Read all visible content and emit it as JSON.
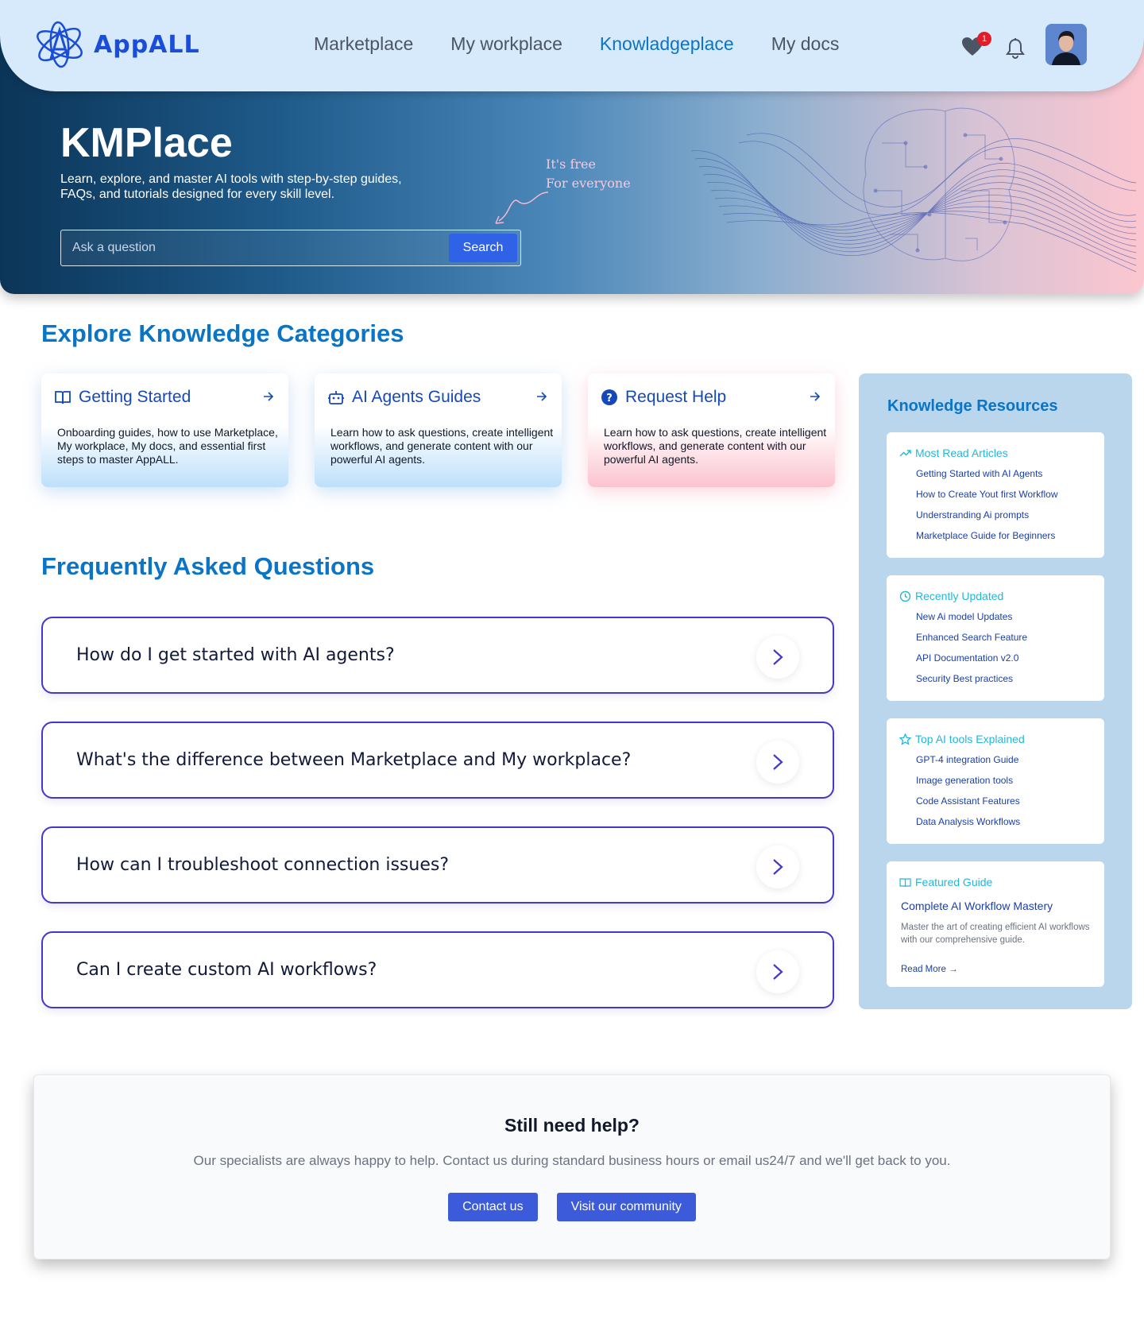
{
  "brand": {
    "name": "AppALL"
  },
  "nav": {
    "links": [
      {
        "label": "Marketplace",
        "active": false
      },
      {
        "label": "My workplace",
        "active": false
      },
      {
        "label": "Knowladgeplace",
        "active": true
      },
      {
        "label": "My docs",
        "active": false
      }
    ],
    "favorites_count": "1"
  },
  "hero": {
    "title": "KMPlace",
    "subtitle": "Learn, explore, and master AI tools with step-by-step guides, FAQs, and tutorials designed for every skill level.",
    "note_line1": "It's free",
    "note_line2": "For everyone",
    "search": {
      "placeholder": "Ask a question",
      "button": "Search"
    }
  },
  "categories": {
    "title": "Explore Knowledge Categories",
    "items": [
      {
        "icon": "book-icon",
        "title": "Getting Started",
        "desc": "Onboarding guides, how to use Marketplace, My workplace, My docs, and essential first steps to master AppALL."
      },
      {
        "icon": "robot-icon",
        "title": "AI Agents Guides",
        "desc": "Learn how to ask questions, create intelligent workflows, and generate content with our powerful AI agents."
      },
      {
        "icon": "help-circle-icon",
        "title": "Request Help",
        "desc": "Learn how to ask questions, create intelligent workflows, and generate content with our powerful AI agents."
      }
    ]
  },
  "faq": {
    "title": "Frequently Asked Questions",
    "items": [
      "How do I get started with AI agents?",
      "What's the difference between Marketplace and My workplace?",
      "How can I troubleshoot connection issues?",
      "Can I create custom AI workflows?"
    ]
  },
  "resources": {
    "title": "Knowledge Resources",
    "most_read": {
      "heading": "Most Read Articles",
      "items": [
        "Getting Started with AI Agents",
        "How to Create Yout first Workflow",
        "Understranding Ai prompts",
        "Marketplace Guide for Beginners"
      ]
    },
    "recent": {
      "heading": "Recently Updated",
      "items": [
        "New Ai model Updates",
        "Enhanced Search Feature",
        "API Documentation v2.0",
        "Security Best practices"
      ]
    },
    "top_tools": {
      "heading": "Top AI tools Explained",
      "items": [
        "GPT-4 integration Guide",
        "Image generation tools",
        "Code Assistant Features",
        "Data Analysis Workflows"
      ]
    },
    "featured": {
      "heading": "Featured Guide",
      "title": "Complete AI Workflow Mastery",
      "desc": "Master the art of creating efficient AI workflows with our comprehensive guide.",
      "link": "Read More →"
    }
  },
  "help": {
    "title": "Still need help?",
    "subtitle": "Our specialists are always happy to help. Contact us during standard business hours or email us24/7 and we'll get back to you.",
    "contact_button": "Contact us",
    "community_button": "Visit our community"
  },
  "colors": {
    "accent": "#0b74c4",
    "button": "#3b5bdb",
    "faq_border": "#4338ca",
    "sidebar_bg": "#b9d6ec"
  }
}
